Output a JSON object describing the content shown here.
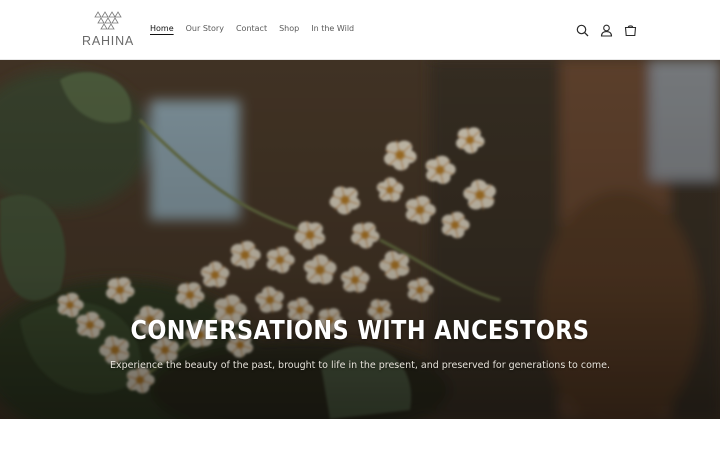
{
  "brand": {
    "name": "RAHINA",
    "logo_icon": "geometric-triangles-logo"
  },
  "nav": {
    "items": [
      {
        "label": "Home",
        "active": true
      },
      {
        "label": "Our Story",
        "active": false
      },
      {
        "label": "Contact",
        "active": false
      },
      {
        "label": "Shop",
        "active": false
      },
      {
        "label": "In the Wild",
        "active": false
      }
    ]
  },
  "header_icons": [
    "search-icon",
    "account-icon",
    "cart-icon"
  ],
  "hero": {
    "title": "CONVERSATIONS WITH ANCESTORS",
    "subtitle": "Experience the beauty of the past, brought to life in the present, and preserved for generations to come.",
    "image": "white-flower-cluster-photo"
  },
  "colors": {
    "text": "#121212",
    "nav_muted": "#5a5a5a",
    "hero_text": "#ffffff"
  }
}
